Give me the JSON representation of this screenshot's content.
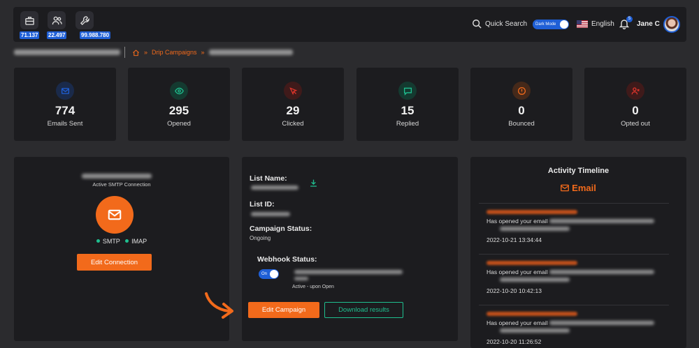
{
  "topbar": {
    "stats": [
      {
        "icon": "briefcase-icon",
        "value": "71.137"
      },
      {
        "icon": "users-icon",
        "value": "22.497"
      },
      {
        "icon": "wrench-icon",
        "value": "99.988.780"
      }
    ],
    "quick_search": "Quick Search",
    "dark_mode_label": "Dark Mode",
    "language": "English",
    "notifications_count": "5",
    "user_name": "Jane C"
  },
  "breadcrumb": {
    "current": "Drip Campaigns"
  },
  "stats_cards": [
    {
      "label": "Emails Sent",
      "value": "774",
      "icon": "mail-icon",
      "color": "#1f5fd6"
    },
    {
      "label": "Opened",
      "value": "295",
      "icon": "eye-icon",
      "color": "#1fbf8f"
    },
    {
      "label": "Clicked",
      "value": "29",
      "icon": "cursor-icon",
      "color": "#e0352b"
    },
    {
      "label": "Replied",
      "value": "15",
      "icon": "chat-icon",
      "color": "#1fbf8f"
    },
    {
      "label": "Bounced",
      "value": "0",
      "icon": "alert-icon",
      "color": "#f26a1b"
    },
    {
      "label": "Opted out",
      "value": "0",
      "icon": "user-x-icon",
      "color": "#e0352b"
    }
  ],
  "smtp": {
    "subtitle": "Active SMTP Connection",
    "smtp_label": "SMTP",
    "imap_label": "IMAP",
    "edit_button": "Edit Connection"
  },
  "campaign": {
    "list_name_label": "List Name:",
    "list_id_label": "List ID:",
    "status_label": "Campaign Status:",
    "status_value": "Ongoing",
    "webhook_label": "Webhook Status:",
    "webhook_toggle": "On",
    "webhook_note": "Active - upon Open",
    "edit_button": "Edit Campaign",
    "download_button": "Download results"
  },
  "timeline": {
    "title": "Activity Timeline",
    "channel": "Email",
    "entries": [
      {
        "action": "Has opened your email",
        "time": "2022-10-21 13:34:44"
      },
      {
        "action": "Has opened your email",
        "time": "2022-10-20 10:42:13"
      },
      {
        "action": "Has opened your email",
        "time": "2022-10-20 11:26:52"
      }
    ]
  },
  "colors": {
    "accent": "#f26a1b",
    "brand_blue": "#1f5fd6",
    "success": "#1fbf8f"
  }
}
